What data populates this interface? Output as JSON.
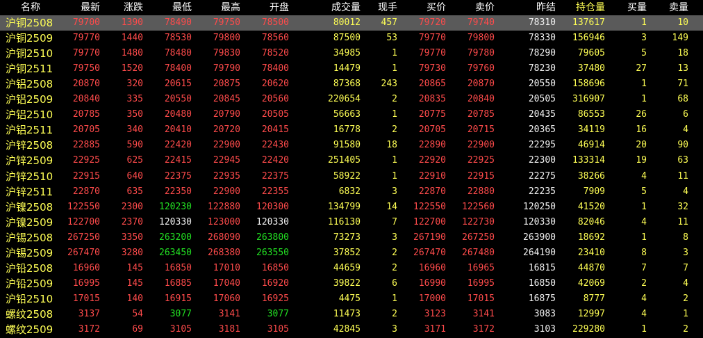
{
  "headers": [
    {
      "label": "名称",
      "key": "name",
      "color": "white"
    },
    {
      "label": "最新",
      "key": "last",
      "color": "white"
    },
    {
      "label": "涨跌",
      "key": "change",
      "color": "white"
    },
    {
      "label": "最低",
      "key": "low",
      "color": "white"
    },
    {
      "label": "最高",
      "key": "high",
      "color": "white"
    },
    {
      "label": "开盘",
      "key": "open",
      "color": "white"
    },
    {
      "label": "成交量",
      "key": "volume",
      "color": "white"
    },
    {
      "label": "现手",
      "key": "lot",
      "color": "white"
    },
    {
      "label": "买价",
      "key": "bid",
      "color": "white"
    },
    {
      "label": "卖价",
      "key": "ask",
      "color": "white"
    },
    {
      "label": "昨结",
      "key": "prev_settle",
      "color": "white"
    },
    {
      "label": "持仓量",
      "key": "open_interest",
      "color": "yellow"
    },
    {
      "label": "买量",
      "key": "bid_vol",
      "color": "white"
    },
    {
      "label": "卖量",
      "key": "ask_vol",
      "color": "white"
    }
  ],
  "colors": {
    "red": "#ff4b4b",
    "green": "#22e022",
    "white": "#f2f2f2",
    "yellow": "#ffff55",
    "selected_row": "#5a5a5a",
    "background": "#000000"
  },
  "selected_row": 0,
  "rows": [
    {
      "name": "沪铜2508",
      "last": "79700",
      "change": "1390",
      "low": "78490",
      "high": "79750",
      "open": "78500",
      "volume": "80012",
      "lot": "457",
      "bid": "79720",
      "ask": "79740",
      "prev_settle": "78310",
      "open_interest": "137617",
      "bid_vol": "1",
      "ask_vol": "10",
      "colors": {
        "low": "red",
        "open": "red"
      }
    },
    {
      "name": "沪铜2509",
      "last": "79770",
      "change": "1440",
      "low": "78530",
      "high": "79800",
      "open": "78560",
      "volume": "87500",
      "lot": "53",
      "bid": "79770",
      "ask": "79800",
      "prev_settle": "78330",
      "open_interest": "156946",
      "bid_vol": "3",
      "ask_vol": "149",
      "colors": {
        "low": "red",
        "open": "red"
      }
    },
    {
      "name": "沪铜2510",
      "last": "79770",
      "change": "1480",
      "low": "78480",
      "high": "79830",
      "open": "78520",
      "volume": "34985",
      "lot": "1",
      "bid": "79770",
      "ask": "79780",
      "prev_settle": "78290",
      "open_interest": "79605",
      "bid_vol": "5",
      "ask_vol": "18",
      "colors": {
        "low": "red",
        "open": "red"
      }
    },
    {
      "name": "沪铜2511",
      "last": "79750",
      "change": "1520",
      "low": "78400",
      "high": "79790",
      "open": "78400",
      "volume": "14479",
      "lot": "1",
      "bid": "79730",
      "ask": "79760",
      "prev_settle": "78230",
      "open_interest": "37480",
      "bid_vol": "27",
      "ask_vol": "13",
      "colors": {
        "low": "red",
        "open": "red"
      }
    },
    {
      "name": "沪铝2508",
      "last": "20870",
      "change": "320",
      "low": "20615",
      "high": "20875",
      "open": "20620",
      "volume": "87368",
      "lot": "243",
      "bid": "20865",
      "ask": "20870",
      "prev_settle": "20550",
      "open_interest": "158696",
      "bid_vol": "1",
      "ask_vol": "71",
      "colors": {
        "low": "red",
        "open": "red"
      }
    },
    {
      "name": "沪铝2509",
      "last": "20840",
      "change": "335",
      "low": "20550",
      "high": "20845",
      "open": "20560",
      "volume": "220654",
      "lot": "2",
      "bid": "20835",
      "ask": "20840",
      "prev_settle": "20505",
      "open_interest": "316907",
      "bid_vol": "1",
      "ask_vol": "68",
      "colors": {
        "low": "red",
        "open": "red"
      }
    },
    {
      "name": "沪铝2510",
      "last": "20785",
      "change": "350",
      "low": "20480",
      "high": "20790",
      "open": "20505",
      "volume": "56663",
      "lot": "1",
      "bid": "20775",
      "ask": "20785",
      "prev_settle": "20435",
      "open_interest": "86553",
      "bid_vol": "26",
      "ask_vol": "6",
      "colors": {
        "low": "red",
        "open": "red"
      }
    },
    {
      "name": "沪铝2511",
      "last": "20705",
      "change": "340",
      "low": "20410",
      "high": "20720",
      "open": "20415",
      "volume": "16778",
      "lot": "2",
      "bid": "20705",
      "ask": "20715",
      "prev_settle": "20365",
      "open_interest": "34119",
      "bid_vol": "16",
      "ask_vol": "4",
      "colors": {
        "low": "red",
        "open": "red"
      }
    },
    {
      "name": "沪锌2508",
      "last": "22885",
      "change": "590",
      "low": "22420",
      "high": "22900",
      "open": "22430",
      "volume": "91580",
      "lot": "18",
      "bid": "22890",
      "ask": "22900",
      "prev_settle": "22295",
      "open_interest": "46914",
      "bid_vol": "20",
      "ask_vol": "90",
      "colors": {
        "low": "red",
        "open": "red"
      }
    },
    {
      "name": "沪锌2509",
      "last": "22925",
      "change": "625",
      "low": "22415",
      "high": "22945",
      "open": "22420",
      "volume": "251405",
      "lot": "1",
      "bid": "22920",
      "ask": "22925",
      "prev_settle": "22300",
      "open_interest": "133314",
      "bid_vol": "19",
      "ask_vol": "63",
      "colors": {
        "low": "red",
        "open": "red"
      }
    },
    {
      "name": "沪锌2510",
      "last": "22915",
      "change": "640",
      "low": "22375",
      "high": "22935",
      "open": "22375",
      "volume": "58922",
      "lot": "1",
      "bid": "22910",
      "ask": "22915",
      "prev_settle": "22275",
      "open_interest": "38266",
      "bid_vol": "4",
      "ask_vol": "11",
      "colors": {
        "low": "red",
        "open": "red"
      }
    },
    {
      "name": "沪锌2511",
      "last": "22870",
      "change": "635",
      "low": "22350",
      "high": "22900",
      "open": "22355",
      "volume": "6832",
      "lot": "3",
      "bid": "22870",
      "ask": "22880",
      "prev_settle": "22235",
      "open_interest": "7909",
      "bid_vol": "5",
      "ask_vol": "4",
      "colors": {
        "low": "red",
        "open": "red"
      }
    },
    {
      "name": "沪镍2508",
      "last": "122550",
      "change": "2300",
      "low": "120230",
      "high": "122880",
      "open": "120300",
      "volume": "134799",
      "lot": "14",
      "bid": "122550",
      "ask": "122560",
      "prev_settle": "120250",
      "open_interest": "41520",
      "bid_vol": "1",
      "ask_vol": "32",
      "colors": {
        "low": "green",
        "open": "red"
      }
    },
    {
      "name": "沪镍2509",
      "last": "122700",
      "change": "2370",
      "low": "120330",
      "high": "123000",
      "open": "120330",
      "volume": "116130",
      "lot": "7",
      "bid": "122700",
      "ask": "122730",
      "prev_settle": "120330",
      "open_interest": "82046",
      "bid_vol": "4",
      "ask_vol": "11",
      "colors": {
        "low": "white",
        "open": "white"
      }
    },
    {
      "name": "沪锡2508",
      "last": "267250",
      "change": "3350",
      "low": "263200",
      "high": "268090",
      "open": "263800",
      "volume": "73273",
      "lot": "3",
      "bid": "267190",
      "ask": "267250",
      "prev_settle": "263900",
      "open_interest": "18692",
      "bid_vol": "1",
      "ask_vol": "8",
      "colors": {
        "low": "green",
        "open": "green"
      }
    },
    {
      "name": "沪锡2509",
      "last": "267470",
      "change": "3280",
      "low": "263450",
      "high": "268380",
      "open": "263550",
      "volume": "37852",
      "lot": "2",
      "bid": "267470",
      "ask": "267480",
      "prev_settle": "264190",
      "open_interest": "23410",
      "bid_vol": "8",
      "ask_vol": "3",
      "colors": {
        "low": "green",
        "open": "green"
      }
    },
    {
      "name": "沪铅2508",
      "last": "16960",
      "change": "145",
      "low": "16850",
      "high": "17010",
      "open": "16850",
      "volume": "44659",
      "lot": "2",
      "bid": "16960",
      "ask": "16965",
      "prev_settle": "16815",
      "open_interest": "44870",
      "bid_vol": "7",
      "ask_vol": "7",
      "colors": {
        "low": "red",
        "open": "red"
      }
    },
    {
      "name": "沪铅2509",
      "last": "16995",
      "change": "145",
      "low": "16885",
      "high": "17040",
      "open": "16920",
      "volume": "39822",
      "lot": "6",
      "bid": "16990",
      "ask": "16995",
      "prev_settle": "16850",
      "open_interest": "42069",
      "bid_vol": "2",
      "ask_vol": "4",
      "colors": {
        "low": "red",
        "open": "red"
      }
    },
    {
      "name": "沪铅2510",
      "last": "17015",
      "change": "140",
      "low": "16915",
      "high": "17060",
      "open": "16925",
      "volume": "4475",
      "lot": "1",
      "bid": "17000",
      "ask": "17015",
      "prev_settle": "16875",
      "open_interest": "8777",
      "bid_vol": "4",
      "ask_vol": "2",
      "colors": {
        "low": "red",
        "open": "red"
      }
    },
    {
      "name": "螺纹2508",
      "last": "3137",
      "change": "54",
      "low": "3077",
      "high": "3141",
      "open": "3077",
      "volume": "11473",
      "lot": "2",
      "bid": "3123",
      "ask": "3141",
      "prev_settle": "3083",
      "open_interest": "12997",
      "bid_vol": "4",
      "ask_vol": "1",
      "colors": {
        "low": "green",
        "open": "green"
      }
    },
    {
      "name": "螺纹2509",
      "last": "3172",
      "change": "69",
      "low": "3105",
      "high": "3181",
      "open": "3105",
      "volume": "42845",
      "lot": "3",
      "bid": "3171",
      "ask": "3172",
      "prev_settle": "3103",
      "open_interest": "229280",
      "bid_vol": "1",
      "ask_vol": "2",
      "colors": {
        "low": "red",
        "open": "red"
      }
    }
  ]
}
